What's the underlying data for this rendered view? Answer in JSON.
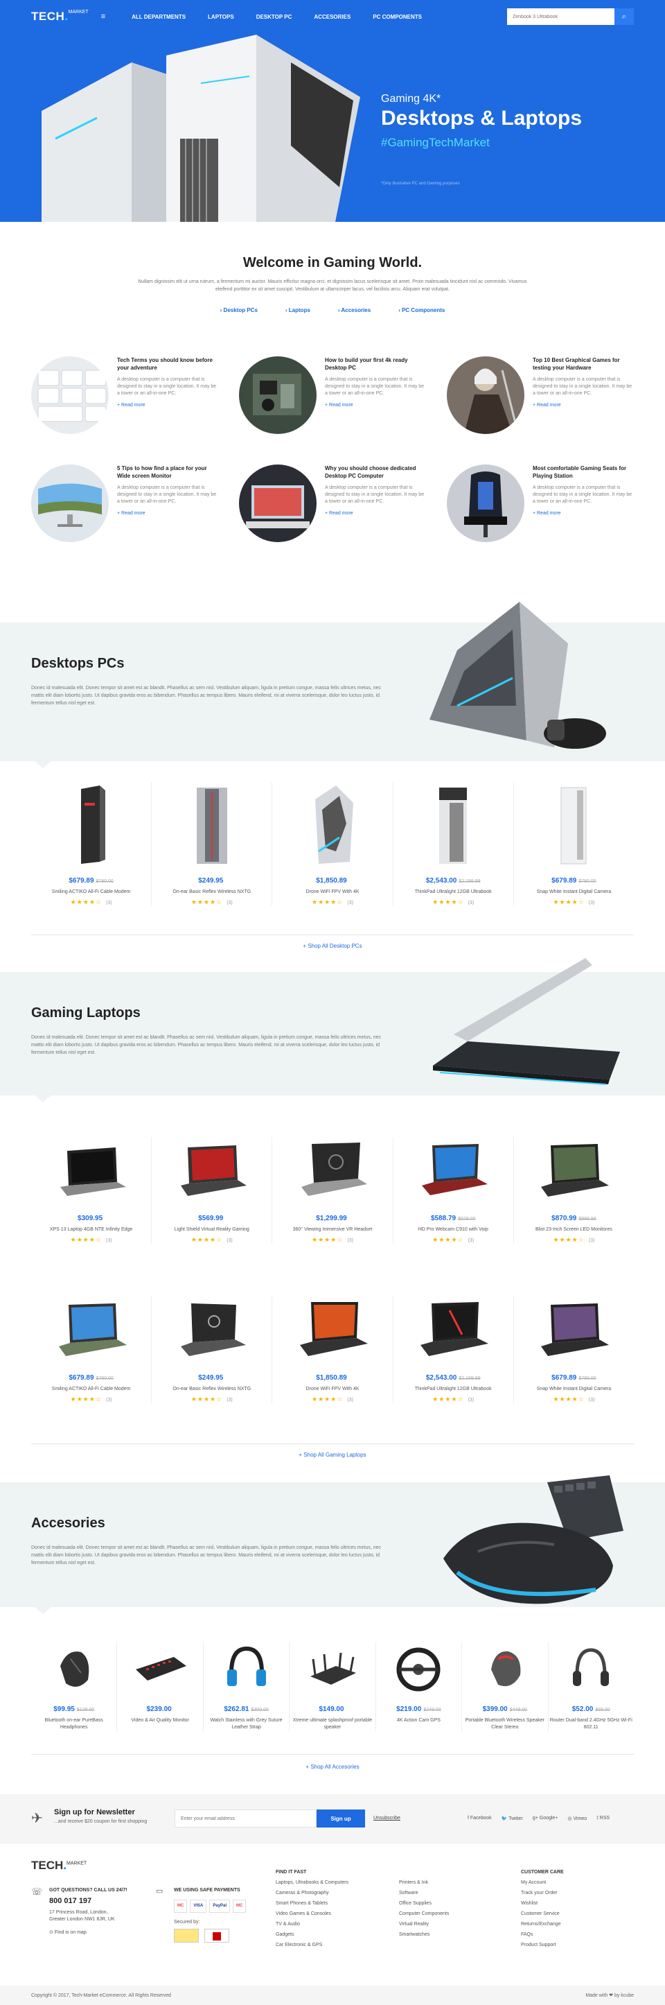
{
  "header": {
    "logo": "TECH",
    "logo_sup": "MARKET",
    "nav": [
      "ALL DEPARTMENTS",
      "LAPTOPS",
      "DESKTOP PC",
      "ACCESORIES",
      "PC COMPONENTS"
    ],
    "search_placeholder": "Zenbook 3 Ultrabook"
  },
  "hero": {
    "line1": "Gaming 4K*",
    "line2": "Desktops & Laptops",
    "line3": "#GamingTechMarket",
    "note": "*Only illustrative PC and Gaming purposes"
  },
  "welcome": {
    "title": "Welcome in Gaming World.",
    "text": "Nullam dignissim elit ut urna rutrum, a fermentum mi auctor. Mauris efficitur magna orci, et dignissim lacus scelerisque sit amet. Proin malesuada tincidunt nisl ac commodo. Vivamus eleifend porttitor ex sit amet suscipit. Vestibulum at ullamcorper lacus, vel facilisis arcu. Aliquam erat volutpat.",
    "links": [
      "Desktop PCs",
      "Laptops",
      "Accesories",
      "PC Components"
    ]
  },
  "articles": [
    {
      "title": "Tech Terms you should know before your adventure",
      "text": "A desktop computer is a computer that is designed to stay in a single location. It may be a tower or an all-in-one PC.",
      "more": "Read more"
    },
    {
      "title": "How to build your first 4k ready Desktop PC",
      "text": "A desktop computer is a computer that is designed to stay in a single location. It may be a tower or an all-in-one PC.",
      "more": "Read more"
    },
    {
      "title": "Top 10 Best Graphical Games for testing your Hardware",
      "text": "A desktop computer is a computer that is designed to stay in a single location. It may be a tower or an all-in-one PC.",
      "more": "Read more"
    },
    {
      "title": "5 Tips to how find a place for your Wide screen Monitor",
      "text": "A desktop computer is a computer that is designed to stay in a single location. It may be a tower or an all-in-one PC.",
      "more": "Read more"
    },
    {
      "title": "Why you should choose dedicated Desktop PC Computer",
      "text": "A desktop computer is a computer that is designed to stay in a single location. It may be a tower or an all-in-one PC.",
      "more": "Read more"
    },
    {
      "title": "Most comfortable Gaming Seats for Playing Station",
      "text": "A desktop computer is a computer that is designed to stay in a single location. It may be a tower or an all-in-one PC.",
      "more": "Read more"
    }
  ],
  "desktops": {
    "title": "Desktops PCs",
    "text": "Donec id malesuada elit. Donec tempor sit amet est ac blandit. Phasellus ac sem nisl. Vestibulum aliquam, ligula in pretium congue, massa felis ultrices metus, nec mattis elit diam lobortis justo. Ut dapibus gravida eros ac bibendum. Phasellus ac tempus libero. Mauris eleifend, mi at viverra scelerisque, dolor leo luctus justo, id fermentum tellus nisl eget est.",
    "products": [
      {
        "price": "$679.89",
        "old": "$780.00",
        "name": "Smiling ACTIKO All-Fi Cable Modem",
        "count": "(3)"
      },
      {
        "price": "$249.95",
        "old": "",
        "name": "On-ear Basic Reflex Wireless NXTG",
        "count": "(3)"
      },
      {
        "price": "$1,850.89",
        "old": "",
        "name": "Drone WiFi FPV With 4K",
        "count": "(3)"
      },
      {
        "price": "$2,543.00",
        "old": "$2,199.99",
        "name": "ThinkPad Ultralight 12GB Ultrabook",
        "count": "(3)"
      },
      {
        "price": "$679.89",
        "old": "$780.00",
        "name": "Snap White Instant Digital Camera",
        "count": "(3)"
      }
    ],
    "shop_all": "+ Shop All Desktop PCs"
  },
  "laptops": {
    "title": "Gaming Laptops",
    "text": "Donec id malesuada elit. Donec tempor sit amet est ac blandit. Phasellus ac sem nisl. Vestibulum aliquam, ligula in pretium congue, massa felis ultrices metus, nec mattis elit diam lobortis justo. Ut dapibus gravida eros ac bibendum. Phasellus ac tempus libero. Mauris eleifend, mi at viverra scelerisque, dolor leo luctus justo, id fermentum tellus nisl eget est.",
    "row1": [
      {
        "price": "$309.95",
        "old": "",
        "name": "XPS 13 Laptop 4GB NTE Infinity Edge",
        "count": "(3)"
      },
      {
        "price": "$569.99",
        "old": "",
        "name": "Light Shield Virtual Reality Gaming",
        "count": "(3)"
      },
      {
        "price": "$1,299.99",
        "old": "",
        "name": "360° Viewing Immersive VR Headset",
        "count": "(3)"
      },
      {
        "price": "$588.79",
        "old": "$629.00",
        "name": "HD Pro Webcam C910 with Voip",
        "count": "(3)"
      },
      {
        "price": "$870.99",
        "old": "$999.99",
        "name": "Blist 23-Inch Screen LED Monitores",
        "count": "(3)"
      }
    ],
    "row2": [
      {
        "price": "$679.89",
        "old": "$780.00",
        "name": "Smiling ACTIKO All-Fi Cable Modem",
        "count": "(3)"
      },
      {
        "price": "$249.95",
        "old": "",
        "name": "On-ear Basic Reflex Wireless NXTG",
        "count": "(3)"
      },
      {
        "price": "$1,850.89",
        "old": "",
        "name": "Drone WiFi FPV With 4K",
        "count": "(3)"
      },
      {
        "price": "$2,543.00",
        "old": "$2,199.99",
        "name": "ThinkPad Ultralight 12GB Ultrabook",
        "count": "(3)"
      },
      {
        "price": "$679.89",
        "old": "$780.00",
        "name": "Snap White Instant Digital Camera",
        "count": "(3)"
      }
    ],
    "shop_all": "+ Shop All Gaming Laptops"
  },
  "accessories": {
    "title": "Accesories",
    "text": "Donec id malesuada elit. Donec tempor sit amet est ac blandit. Phasellus ac sem nisl. Vestibulum aliquam, ligula in pretium congue, massa felis ultrices metus, nec mattis elit diam lobortis justo. Ut dapibus gravida eros ac bibendum. Phasellus ac tempus libero. Mauris eleifend, mi at viverra scelerisque, dolor leo luctus justo, id fermentum tellus nisl eget est.",
    "products": [
      {
        "price": "$99.95",
        "old": "$129.00",
        "name": "Bluetooth on-ear PureBass Headphones"
      },
      {
        "price": "$239.00",
        "old": "",
        "name": "Video & Air Quality Monitor"
      },
      {
        "price": "$262.81",
        "old": "$300.00",
        "name": "Watch Stainless with Grey Suture Leather Strap"
      },
      {
        "price": "$149.00",
        "old": "",
        "name": "Xtreme ultimate splashproof portable speaker"
      },
      {
        "price": "$219.00",
        "old": "$249.00",
        "name": "4K Action Cam GPS"
      },
      {
        "price": "$399.00",
        "old": "$449.00",
        "name": "Portable Bluetooth Wireless Speaker Clear Stereo"
      },
      {
        "price": "$52.00",
        "old": "$65.00",
        "name": "Router Dual-band 2.4GHz 5GHz Wi-Fi 802.11"
      }
    ],
    "shop_all": "+ Shop All Accesories"
  },
  "newsletter": {
    "title": "Sign up for Newsletter",
    "sub": "...and receive $20 coupon for first shopping",
    "placeholder": "Enter your email address",
    "button": "Sign up",
    "unsub": "Unsubscribe",
    "social": [
      "Facebook",
      "Twitter",
      "Google+",
      "Vimeo",
      "RSS"
    ]
  },
  "footer": {
    "logo": "TECH",
    "logo_sup": "MARKET",
    "question": "GOT QUESTIONS? CALL US 24/7!",
    "phone": "800 017 197",
    "address": [
      "17 Princess Road, London,",
      "Greater London NW1 8JR, UK"
    ],
    "map": "Find is on map",
    "pay_title": "WE USING SAFE PAYMENTS",
    "pay": [
      "MC",
      "VISA",
      "PayPal",
      "MC"
    ],
    "secured": "Secured by:",
    "find_title": "FIND IT FAST",
    "find_col1": [
      "Laptops, Ultrabooks & Computers",
      "Cameras & Photography",
      "Smart Phones & Tablets",
      "Video Games & Consoles",
      "TV & Audio",
      "Gadgets",
      "Car Electronic & GPS"
    ],
    "find_col2": [
      "Printers & Ink",
      "Software",
      "Office Supplies",
      "Computer Components",
      "Virtual Reality",
      "Smartwatches"
    ],
    "care_title": "CUSTOMER CARE",
    "care": [
      "My Account",
      "Track your Order",
      "Wishlist",
      "Customer Service",
      "Returns/Exchange",
      "FAQs",
      "Product Support"
    ],
    "copyright": "Copyright © 2017, Tech-Market eCommerce. All Rights Reserved",
    "madewith": "Made with ❤ by kcube"
  },
  "colors": {
    "brand": "#1e6ae0",
    "accent": "#2fd0ff",
    "star": "#f4b400"
  }
}
